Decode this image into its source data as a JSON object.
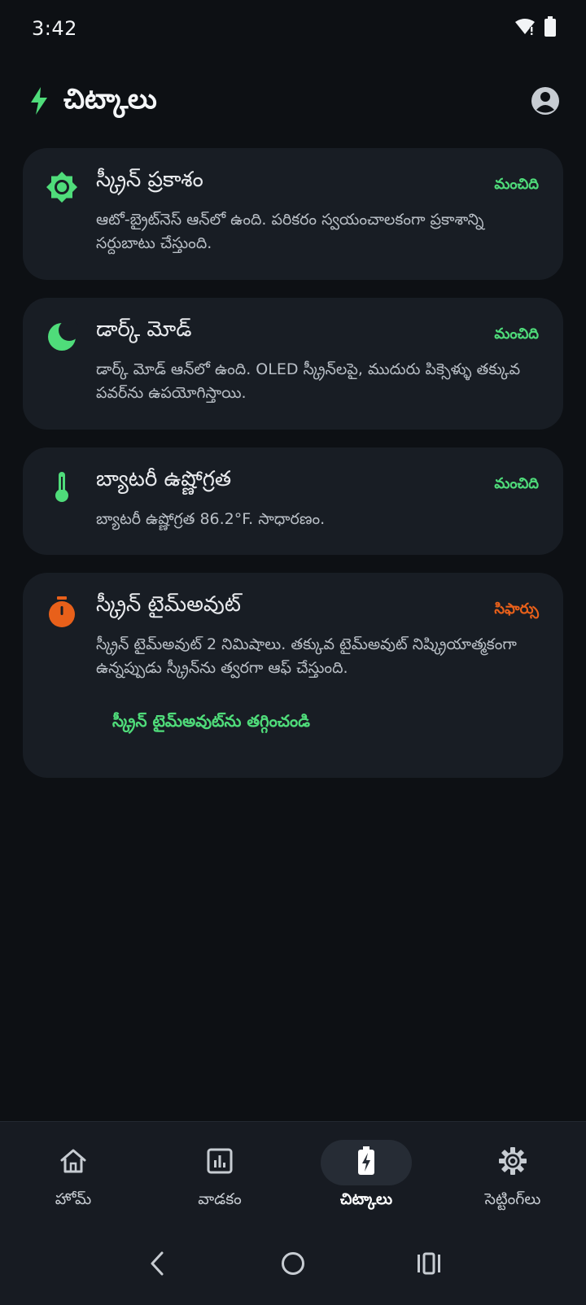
{
  "status_bar": {
    "time": "3:42",
    "wifi_icon": "wifi-icon",
    "battery_icon": "battery-icon"
  },
  "header": {
    "title": "చిట్కాలు",
    "logo_icon": "bolt-icon",
    "account_icon": "account-circle-icon"
  },
  "colors": {
    "good": "#4fdc7a",
    "recommend": "#e8601a",
    "background": "#0d1014",
    "card": "#181d24"
  },
  "tips": [
    {
      "icon": "brightness-icon",
      "title": "స్క్రీన్ ప్రకాశం",
      "badge": "మంచిది",
      "status": "good",
      "description": "ఆటో-బ్రైట్‌నెస్ ఆన్‌లో ఉంది. పరికరం స్వయంచాలకంగా ప్రకాశాన్ని సర్దుబాటు చేస్తుంది."
    },
    {
      "icon": "moon-icon",
      "title": "డార్క్ మోడ్",
      "badge": "మంచిది",
      "status": "good",
      "description": "డార్క్ మోడ్ ఆన్‌లో ఉంది. OLED స్క్రీన్‌లపై, ముదురు పిక్సెళ్ళు తక్కువ పవర్‌ను ఉపయోగిస్తాయి."
    },
    {
      "icon": "thermometer-icon",
      "title": "బ్యాటరీ ఉష్ణోగ్రత",
      "badge": "మంచిది",
      "status": "good",
      "description": "బ్యాటరీ ఉష్ణోగ్రత 86.2°F. సాధారణం."
    },
    {
      "icon": "timer-icon",
      "title": "స్క్రీన్ టైమ్‌అవుట్",
      "badge": "సిఫార్సు",
      "status": "recommend",
      "description": "స్క్రీన్ టైమ్‌అవుట్ 2 నిమిషాలు. తక్కువ టైమ్‌అవుట్ నిష్క్రియాత్మకంగా ఉన్నప్పుడు స్క్రీన్‌ను త్వరగా ఆఫ్ చేస్తుంది.",
      "action": "స్క్రీన్ టైమ్‌అవుట్‌ను తగ్గించండి"
    }
  ],
  "bottom_nav": [
    {
      "label": "హోమ్",
      "icon": "home-icon",
      "active": false
    },
    {
      "label": "వాడకం",
      "icon": "bar-chart-icon",
      "active": false
    },
    {
      "label": "చిట్కాలు",
      "icon": "battery-bolt-icon",
      "active": true
    },
    {
      "label": "సెట్టింగ్‌లు",
      "icon": "gear-icon",
      "active": false
    }
  ],
  "system_nav": {
    "back_icon": "back-icon",
    "home_icon": "home-circle-icon",
    "recents_icon": "recents-icon"
  }
}
